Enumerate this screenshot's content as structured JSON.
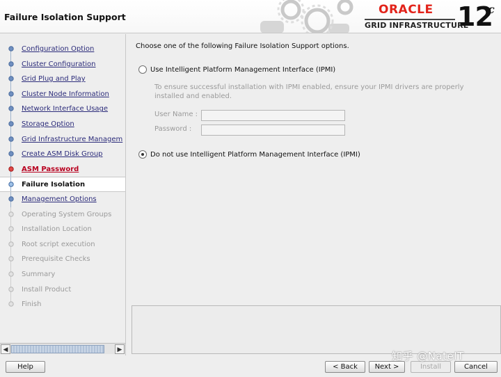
{
  "header": {
    "title": "Failure Isolation Support",
    "brand_name": "ORACLE",
    "brand_product": "GRID INFRASTRUCTURE",
    "version_number": "12",
    "version_suffix": "c"
  },
  "sidebar": {
    "steps": [
      {
        "label": "Configuration Option",
        "state": "done"
      },
      {
        "label": "Cluster Configuration",
        "state": "done"
      },
      {
        "label": "Grid Plug and Play",
        "state": "done"
      },
      {
        "label": "Cluster Node Information",
        "state": "done"
      },
      {
        "label": "Network Interface Usage",
        "state": "done"
      },
      {
        "label": "Storage Option",
        "state": "done"
      },
      {
        "label": "Grid Infrastructure Managem",
        "state": "done"
      },
      {
        "label": "Create ASM Disk Group",
        "state": "done"
      },
      {
        "label": "ASM Password",
        "state": "error"
      },
      {
        "label": "Failure Isolation",
        "state": "current"
      },
      {
        "label": "Management Options",
        "state": "done"
      },
      {
        "label": "Operating System Groups",
        "state": "future"
      },
      {
        "label": "Installation Location",
        "state": "future"
      },
      {
        "label": "Root script execution",
        "state": "future"
      },
      {
        "label": "Prerequisite Checks",
        "state": "future"
      },
      {
        "label": "Summary",
        "state": "future"
      },
      {
        "label": "Install Product",
        "state": "future"
      },
      {
        "label": "Finish",
        "state": "future"
      }
    ]
  },
  "main": {
    "intro": "Choose one of the following Failure Isolation Support options.",
    "option_ipmi": {
      "label": "Use Intelligent Platform Management Interface (IPMI)",
      "selected": false
    },
    "hint": "To ensure successful installation with IPMI enabled, ensure your IPMI drivers are properly installed and enabled.",
    "username_label": "User Name :",
    "username_value": "",
    "password_label": "Password :",
    "password_value": "",
    "option_no_ipmi": {
      "label": "Do not use Intelligent Platform Management Interface (IPMI)",
      "selected": true
    }
  },
  "footer": {
    "help": "Help",
    "back": "< Back",
    "next": "Next >",
    "install": "Install",
    "cancel": "Cancel"
  },
  "watermark": "知乎 @NateIT",
  "colors": {
    "oracle_red": "#e2231a",
    "link": "#2b2b7a",
    "error": "#b8001f",
    "disabled": "#9a9a9a"
  }
}
